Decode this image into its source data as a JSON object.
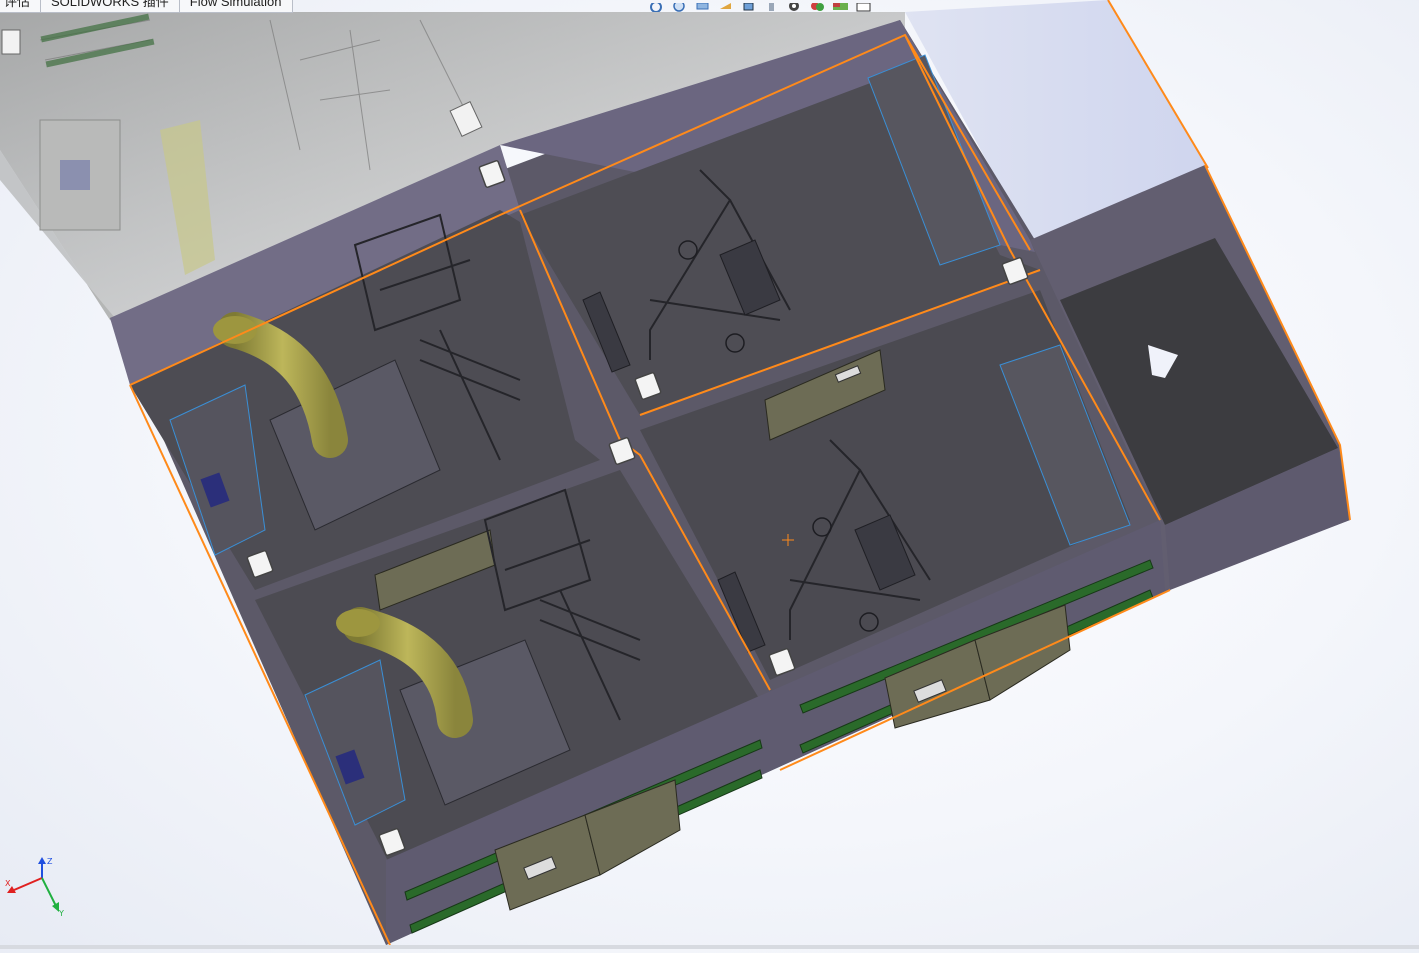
{
  "app": {
    "tabs": [
      {
        "label": "评估"
      },
      {
        "label": "SOLIDWORKS 插件"
      },
      {
        "label": "Flow Simulation"
      }
    ]
  },
  "heads_up_toolbar": {
    "icons": [
      "zoom-to-fit-icon",
      "zoom-area-icon",
      "previous-view-icon",
      "section-view-icon",
      "view-orientation-icon",
      "display-style-icon",
      "hide-show-icon",
      "edit-appearance-icon",
      "apply-scene-icon",
      "view-settings-icon"
    ]
  },
  "triad": {
    "axes": [
      {
        "name": "x-axis",
        "label": "X",
        "color": "#e02020"
      },
      {
        "name": "y-axis",
        "label": "Y",
        "color": "#20b040"
      },
      {
        "name": "z-axis",
        "label": "Z",
        "color": "#2050e0"
      }
    ]
  },
  "model": {
    "description_colors": {
      "enclosure": "#5d5a68",
      "walls": "#6f6a80",
      "floor": "#55545b",
      "selection_outline": "#ff8a1a",
      "duct": "#a8a14a",
      "green_strip": "#2a6a2a",
      "panel_door": "#6d6c55",
      "blue_detail": "#3a8fd6"
    }
  }
}
